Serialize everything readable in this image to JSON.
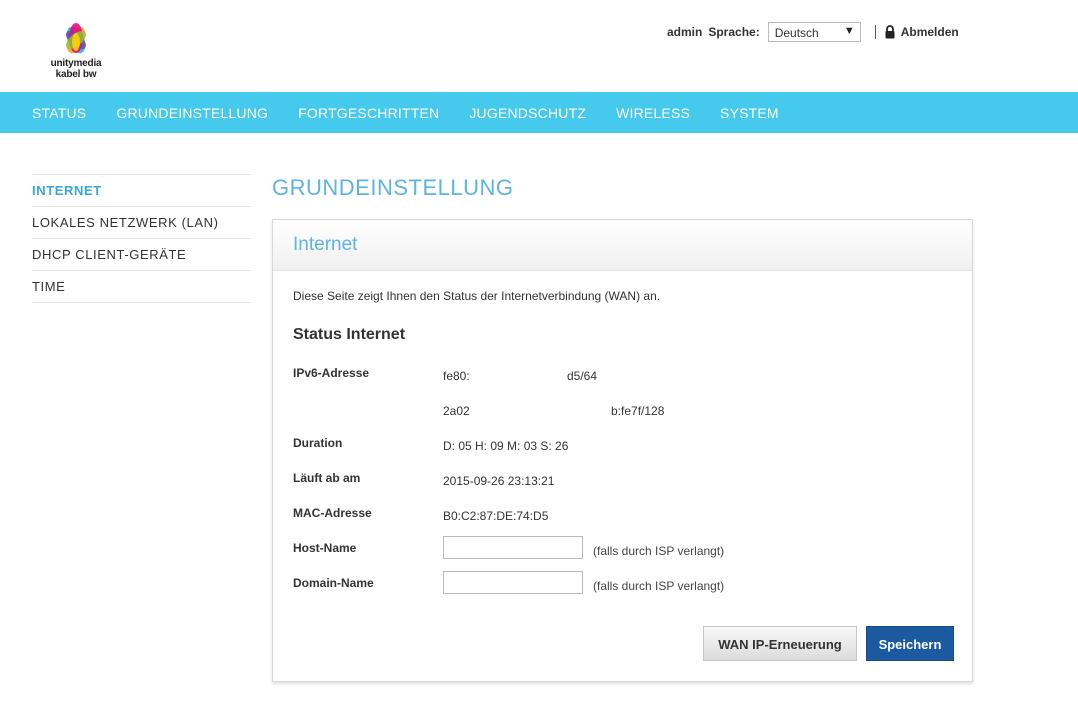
{
  "brand": {
    "line1": "unitymedia",
    "line2": "kabel bw"
  },
  "topbar": {
    "user": "admin",
    "language_label": "Sprache:",
    "language_selected": "Deutsch",
    "dropdown_arrow": "▼",
    "logout": "Abmelden"
  },
  "nav": [
    "STATUS",
    "GRUNDEINSTELLUNG",
    "FORTGESCHRITTEN",
    "JUGENDSCHUTZ",
    "WIRELESS",
    "SYSTEM"
  ],
  "sidebar": [
    {
      "label": "INTERNET",
      "active": true
    },
    {
      "label": "LOKALES NETZWERK (LAN)",
      "active": false
    },
    {
      "label": "DHCP CLIENT-GERÄTE",
      "active": false
    },
    {
      "label": "TIME",
      "active": false
    }
  ],
  "page_title": "GRUNDEINSTELLUNG",
  "panel": {
    "title": "Internet",
    "description": "Diese Seite zeigt Ihnen den Status der Internetverbindung (WAN) an.",
    "section_title": "Status Internet",
    "ipv6": {
      "label": "IPv6-Adresse",
      "addr1_start": "fe80:",
      "addr1_end": "d5/64",
      "addr2_start": "2a02",
      "addr2_end": "b:fe7f/128"
    },
    "duration": {
      "label": "Duration",
      "value": "D: 05 H: 09 M: 03 S: 26"
    },
    "expires": {
      "label": "Läuft ab am",
      "value": "2015-09-26 23:13:21"
    },
    "mac": {
      "label": "MAC-Adresse",
      "value": "B0:C2:87:DE:74:D5"
    },
    "hostname": {
      "label": "Host-Name",
      "value": "",
      "hint": "(falls durch ISP verlangt)"
    },
    "domainname": {
      "label": "Domain-Name",
      "value": "",
      "hint": "(falls durch ISP verlangt)"
    },
    "buttons": {
      "wan_renew": "WAN IP-Erneuerung",
      "save": "Speichern"
    }
  },
  "colors": {
    "nav_bg": "#45c9ec",
    "accent": "#5db4df",
    "save_button": "#1c5aa0"
  },
  "icons": {
    "logo": "unitymedia-flame-logo",
    "logout": "lock-icon"
  }
}
